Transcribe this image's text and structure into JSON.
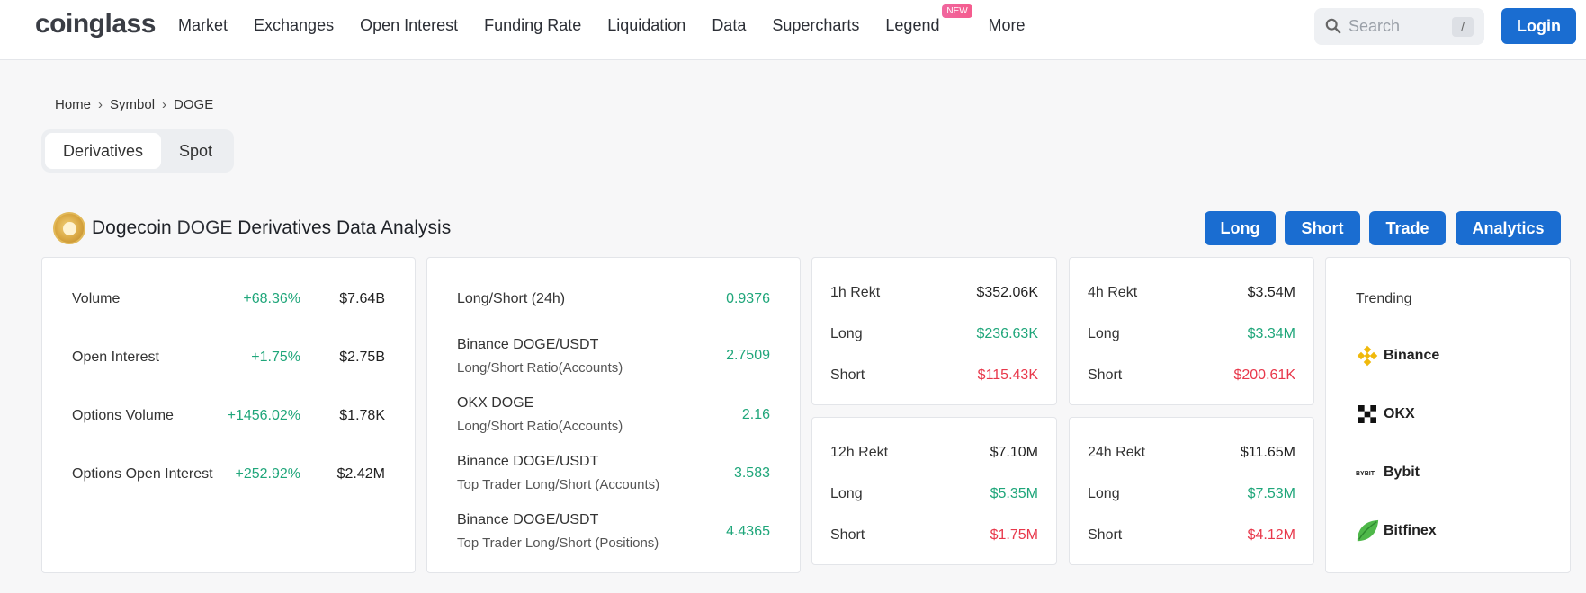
{
  "header": {
    "logo": "coinglass",
    "nav": [
      "Market",
      "Exchanges",
      "Open Interest",
      "Funding Rate",
      "Liquidation",
      "Data",
      "Supercharts",
      "Legend",
      "More"
    ],
    "legend_badge": "NEW",
    "search_placeholder": "Search",
    "search_shortcut": "/",
    "login_label": "Login"
  },
  "breadcrumb": [
    "Home",
    "Symbol",
    "DOGE"
  ],
  "tabs": [
    "Derivatives",
    "Spot"
  ],
  "title": {
    "name": "Dogecoin",
    "symbol": "DOGE",
    "rest": "Derivatives Data Analysis"
  },
  "actions": [
    "Long",
    "Short",
    "Trade",
    "Analytics"
  ],
  "stats": [
    {
      "label": "Volume",
      "change": "+68.36%",
      "value": "$7.64B"
    },
    {
      "label": "Open Interest",
      "change": "+1.75%",
      "value": "$2.75B"
    },
    {
      "label": "Options Volume",
      "change": "+1456.02%",
      "value": "$1.78K"
    },
    {
      "label": "Options Open Interest",
      "change": "+252.92%",
      "value": "$2.42M"
    }
  ],
  "ratios": {
    "main_label": "Long/Short (24h)",
    "main_value": "0.9376",
    "items": [
      {
        "title": "Binance DOGE/USDT",
        "subtitle": "Long/Short Ratio(Accounts)",
        "value": "2.7509"
      },
      {
        "title": "OKX DOGE",
        "subtitle": "Long/Short Ratio(Accounts)",
        "value": "2.16"
      },
      {
        "title": "Binance DOGE/USDT",
        "subtitle": "Top Trader Long/Short (Accounts)",
        "value": "3.583"
      },
      {
        "title": "Binance DOGE/USDT",
        "subtitle": "Top Trader Long/Short (Positions)",
        "value": "4.4365"
      }
    ]
  },
  "rekt": [
    {
      "label": "1h Rekt",
      "total": "$352.06K",
      "long_label": "Long",
      "long": "$236.63K",
      "short_label": "Short",
      "short": "$115.43K"
    },
    {
      "label": "4h Rekt",
      "total": "$3.54M",
      "long_label": "Long",
      "long": "$3.34M",
      "short_label": "Short",
      "short": "$200.61K"
    },
    {
      "label": "12h Rekt",
      "total": "$7.10M",
      "long_label": "Long",
      "long": "$5.35M",
      "short_label": "Short",
      "short": "$1.75M"
    },
    {
      "label": "24h Rekt",
      "total": "$11.65M",
      "long_label": "Long",
      "long": "$7.53M",
      "short_label": "Short",
      "short": "$4.12M"
    }
  ],
  "trending": {
    "title": "Trending",
    "items": [
      {
        "name": "Binance",
        "icon": "binance-icon"
      },
      {
        "name": "OKX",
        "icon": "okx-icon"
      },
      {
        "name": "Bybit",
        "icon": "bybit-icon"
      },
      {
        "name": "Bitfinex",
        "icon": "bitfinex-icon"
      }
    ]
  },
  "colors": {
    "accent": "#1a6dd1",
    "positive": "#1fa67a",
    "negative": "#e8384b",
    "badge": "#f0679f"
  }
}
